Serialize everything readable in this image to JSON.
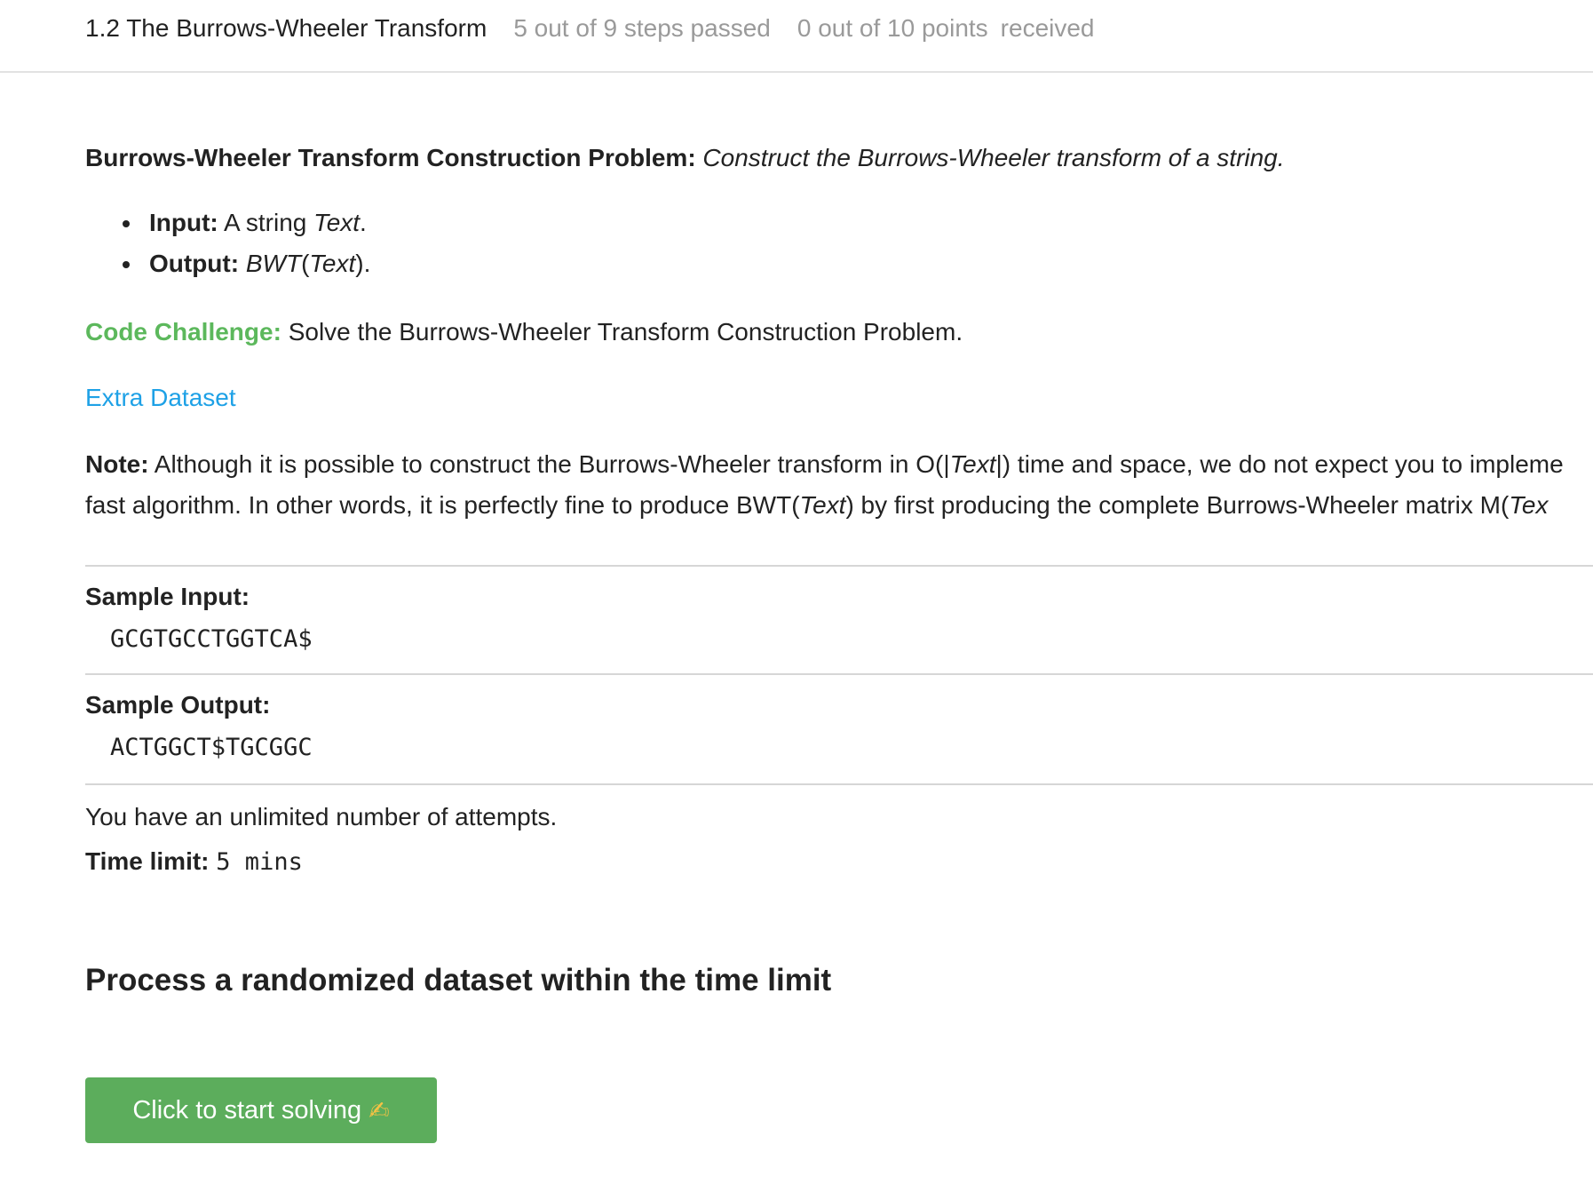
{
  "header": {
    "lesson_title": "1.2 The Burrows-Wheeler Transform",
    "progress": "5 out of 9 steps passed",
    "points_part1": "0 out of 10 points",
    "points_part2": "received"
  },
  "problem": {
    "title": "Burrows-Wheeler Transform Construction Problem:",
    "description": "Construct the Burrows-Wheeler transform of a string.",
    "input_label": "Input:",
    "input_text_prefix": "A string ",
    "input_text_var": "Text",
    "input_text_suffix": ".",
    "output_label": "Output:",
    "output_func": "BWT",
    "output_open": "(",
    "output_var": "Text",
    "output_close": ")."
  },
  "challenge": {
    "label": "Code Challenge:",
    "text": "Solve the Burrows-Wheeler Transform Construction Problem."
  },
  "extra_dataset_link": "Extra Dataset",
  "note": {
    "label": "Note:",
    "line1_a": "Although it is possible to construct the Burrows-Wheeler transform in O(|",
    "line1_var": "Text",
    "line1_b": "|) time and space, we do not expect you to impleme",
    "line2_a": "fast algorithm. In other words, it is perfectly fine to produce BWT(",
    "line2_var": "Text",
    "line2_b": ") by first producing the complete Burrows-Wheeler matrix M(",
    "line2_var2": "Tex"
  },
  "sample_input": {
    "label": "Sample Input:",
    "value": "GCGTGCCTGGTCA$"
  },
  "sample_output": {
    "label": "Sample Output:",
    "value": "ACTGGCT$TGCGGC"
  },
  "attempts_text": "You have an unlimited number of attempts.",
  "time_limit": {
    "label": "Time limit:",
    "value": "5 mins"
  },
  "section_title": "Process a randomized dataset within the time limit",
  "start_button": {
    "label": "Click to start solving",
    "icon_glyph": "✍"
  }
}
